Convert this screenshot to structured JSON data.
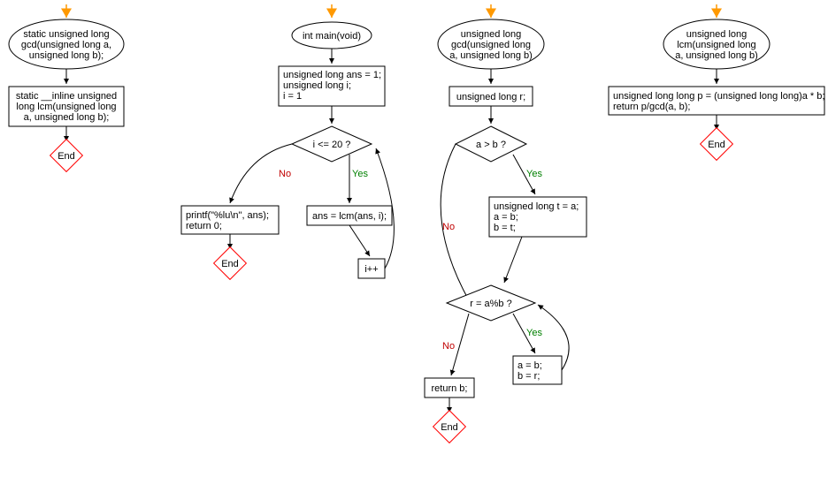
{
  "flowchart1": {
    "start": {
      "line1": "static unsigned long",
      "line2": "gcd(unsigned long a,",
      "line3": "unsigned long b);"
    },
    "box1": {
      "line1": "static __inline unsigned",
      "line2": "long lcm(unsigned long",
      "line3": "a, unsigned long b);"
    },
    "end": "End"
  },
  "flowchart2": {
    "start": "int main(void)",
    "box1": {
      "line1": "unsigned long ans = 1;",
      "line2": "unsigned long i;",
      "line3": "i = 1"
    },
    "decision1": "i <= 20 ?",
    "no_label": "No",
    "yes_label": "Yes",
    "box_no": {
      "line1": "printf(\"%lu\\n\", ans);",
      "line2": "return 0;"
    },
    "box_yes": "ans = lcm(ans, i);",
    "box_inc": "i++",
    "end": "End"
  },
  "flowchart3": {
    "start": {
      "line1": "unsigned long",
      "line2": "gcd(unsigned long",
      "line3": "a, unsigned long b)"
    },
    "box1": "unsigned long r;",
    "decision1": "a > b ?",
    "no_label": "No",
    "yes_label": "Yes",
    "box_yes": {
      "line1": "unsigned long t = a;",
      "line2": "a = b;",
      "line3": "b = t;"
    },
    "decision2": "r = a%b ?",
    "box_yes2": {
      "line1": "a = b;",
      "line2": "b = r;"
    },
    "box_return": "return b;",
    "end": "End"
  },
  "flowchart4": {
    "start": {
      "line1": "unsigned long",
      "line2": "lcm(unsigned long",
      "line3": "a, unsigned long b)"
    },
    "box1": {
      "line1": "unsigned long long p = (unsigned long long)a * b;",
      "line2": "return p/gcd(a, b);"
    },
    "end": "End"
  }
}
